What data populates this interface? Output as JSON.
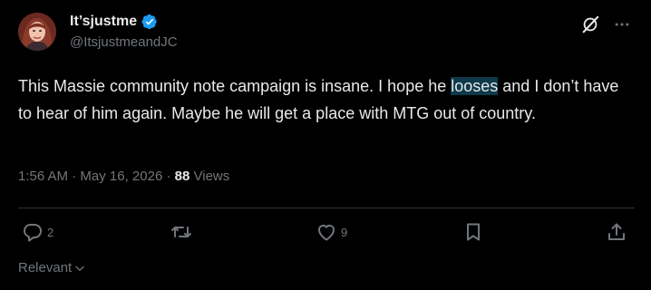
{
  "user": {
    "display_name": "It’sjustme",
    "handle": "@ItsjustmeandJC"
  },
  "tweet": {
    "text_before": "This Massie community note campaign is insane. I hope he ",
    "text_highlight": "looses",
    "text_after": " and I don’t have to hear of him again. Maybe he will get a place with MTG out of country.",
    "time": "1:56 AM",
    "date": "May 16, 2026",
    "views_count": "88",
    "views_label": "Views",
    "separator": "·"
  },
  "actions": {
    "replies": "2",
    "reposts": "",
    "likes": "9"
  },
  "sort": {
    "label": "Relevant"
  },
  "colors": {
    "background": "#000000",
    "text": "#e7e9ea",
    "secondary": "#71767b",
    "verified": "#1d9bf0",
    "highlight": "#0e3a4a",
    "divider": "#2f3336"
  },
  "icons": {
    "verified": "verified-badge-icon",
    "grok": "grok-icon",
    "more": "more-icon",
    "reply": "reply-icon",
    "repost": "repost-icon",
    "like": "like-icon",
    "bookmark": "bookmark-icon",
    "share": "share-icon",
    "chevron": "chevron-down-icon"
  }
}
